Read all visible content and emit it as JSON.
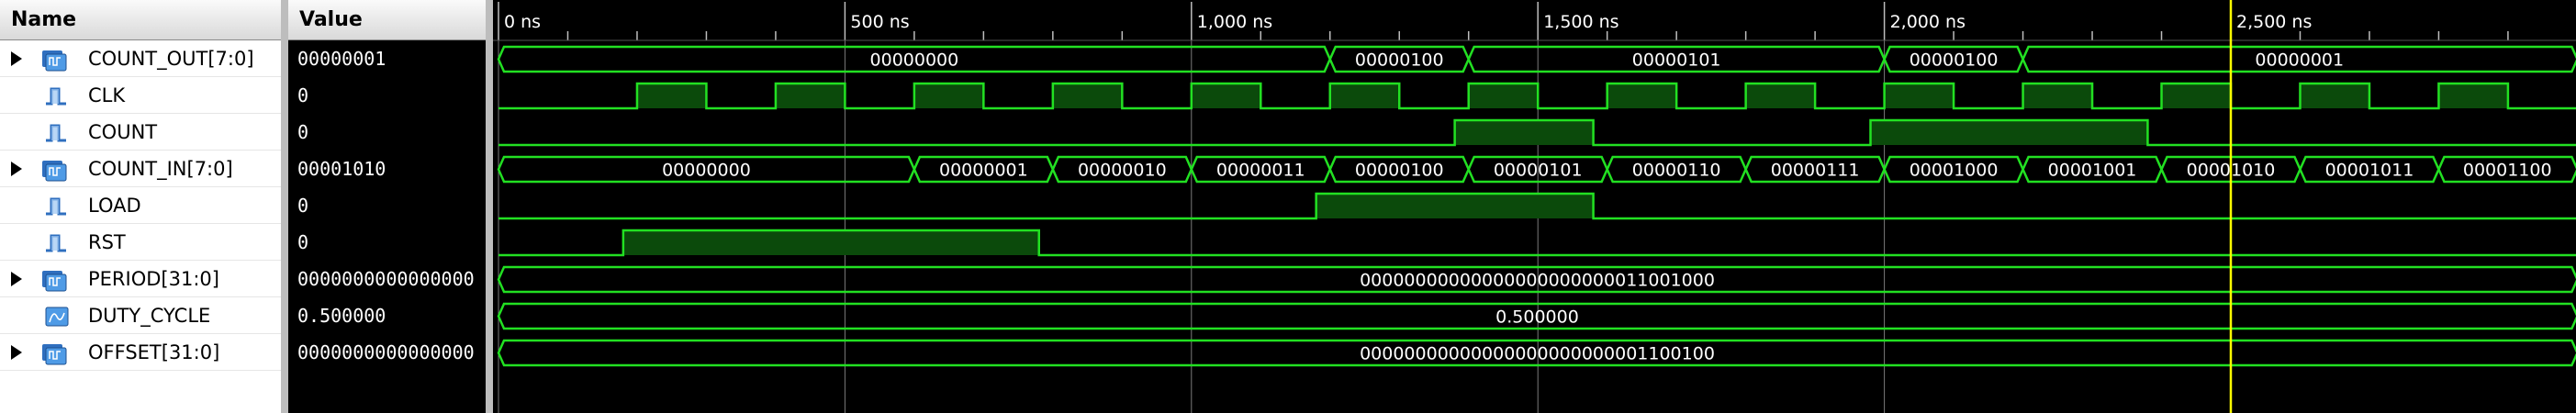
{
  "columns": {
    "name_header": "Name",
    "value_header": "Value"
  },
  "timeline": {
    "ticks": [
      "0 ns",
      "500 ns",
      "1,000 ns",
      "1,500 ns",
      "2,000 ns",
      "2,500 ns"
    ],
    "cursor_ns": 2500
  },
  "colors": {
    "wave": "#22e022",
    "wave_fill": "#0b4a0b",
    "cursor": "#ffff00",
    "grid": "#7a7a7a",
    "text": "#ffffff"
  },
  "signals": [
    {
      "name": "COUNT_OUT[7:0]",
      "value": "00000001",
      "type": "bus",
      "icon": "bus-signal-icon",
      "expandable": true,
      "segments": [
        {
          "start": 0,
          "end": 1200,
          "label": "00000000"
        },
        {
          "start": 1200,
          "end": 1400,
          "label": "00000100"
        },
        {
          "start": 1400,
          "end": 2000,
          "label": "00000101"
        },
        {
          "start": 2000,
          "end": 2200,
          "label": "00000100"
        },
        {
          "start": 2200,
          "end": 3000,
          "label": "00000001"
        }
      ]
    },
    {
      "name": "CLK",
      "value": "0",
      "type": "bit",
      "icon": "bit-signal-icon",
      "expandable": false,
      "high": [
        [
          200,
          300
        ],
        [
          400,
          500
        ],
        [
          600,
          700
        ],
        [
          800,
          900
        ],
        [
          1000,
          1100
        ],
        [
          1200,
          1300
        ],
        [
          1400,
          1500
        ],
        [
          1600,
          1700
        ],
        [
          1800,
          1900
        ],
        [
          2000,
          2100
        ],
        [
          2200,
          2300
        ],
        [
          2400,
          2500
        ],
        [
          2600,
          2700
        ],
        [
          2800,
          2900
        ]
      ]
    },
    {
      "name": "COUNT",
      "value": "0",
      "type": "bit",
      "icon": "bit-signal-icon",
      "expandable": false,
      "high": [
        [
          1380,
          1580
        ],
        [
          1980,
          2380
        ]
      ]
    },
    {
      "name": "COUNT_IN[7:0]",
      "value": "00001010",
      "type": "bus",
      "icon": "bus-signal-icon",
      "expandable": true,
      "segments": [
        {
          "start": 0,
          "end": 600,
          "label": "00000000"
        },
        {
          "start": 600,
          "end": 800,
          "label": "00000001"
        },
        {
          "start": 800,
          "end": 1000,
          "label": "00000010"
        },
        {
          "start": 1000,
          "end": 1200,
          "label": "00000011"
        },
        {
          "start": 1200,
          "end": 1400,
          "label": "00000100"
        },
        {
          "start": 1400,
          "end": 1600,
          "label": "00000101"
        },
        {
          "start": 1600,
          "end": 1800,
          "label": "00000110"
        },
        {
          "start": 1800,
          "end": 2000,
          "label": "00000111"
        },
        {
          "start": 2000,
          "end": 2200,
          "label": "00001000"
        },
        {
          "start": 2200,
          "end": 2400,
          "label": "00001001"
        },
        {
          "start": 2400,
          "end": 2600,
          "label": "00001010"
        },
        {
          "start": 2600,
          "end": 2800,
          "label": "00001011"
        },
        {
          "start": 2800,
          "end": 3000,
          "label": "00001100"
        }
      ]
    },
    {
      "name": "LOAD",
      "value": "0",
      "type": "bit",
      "icon": "bit-signal-icon",
      "expandable": false,
      "high": [
        [
          1180,
          1580
        ]
      ]
    },
    {
      "name": "RST",
      "value": "0",
      "type": "bit",
      "icon": "bit-signal-icon",
      "expandable": false,
      "high": [
        [
          180,
          780
        ]
      ]
    },
    {
      "name": "PERIOD[31:0]",
      "value": "0000000000000000",
      "type": "bus",
      "icon": "bus-signal-icon",
      "expandable": true,
      "segments": [
        {
          "start": 0,
          "end": 3000,
          "label": "00000000000000000000000011001000"
        }
      ]
    },
    {
      "name": "DUTY_CYCLE",
      "value": "0.500000",
      "type": "bus",
      "icon": "real-signal-icon",
      "expandable": false,
      "segments": [
        {
          "start": 0,
          "end": 3000,
          "label": "0.500000"
        }
      ]
    },
    {
      "name": "OFFSET[31:0]",
      "value": "0000000000000000",
      "type": "bus",
      "icon": "bus-signal-icon",
      "expandable": true,
      "segments": [
        {
          "start": 0,
          "end": 3000,
          "label": "00000000000000000000000001100100"
        }
      ]
    }
  ]
}
